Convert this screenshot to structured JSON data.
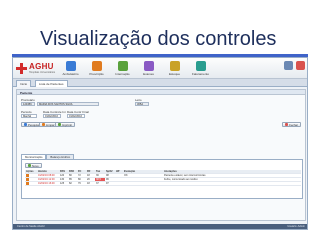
{
  "slide": {
    "title": "Visualização dos controles"
  },
  "app": {
    "logo": {
      "name": "AGHU",
      "tagline": "Hospitais Universitários"
    },
    "modules": [
      {
        "label": "Ambulatório",
        "icon": "stethoscope-icon",
        "color": "#3a7bd5"
      },
      {
        "label": "Prescrição",
        "icon": "pill-icon",
        "color": "#e07b1f"
      },
      {
        "label": "Internação",
        "icon": "bed-icon",
        "color": "#5aa13c"
      },
      {
        "label": "Exames",
        "icon": "microscope-icon",
        "color": "#8a5ac4"
      },
      {
        "label": "Estoque",
        "icon": "box-icon",
        "color": "#c9a227"
      },
      {
        "label": "Faturamento",
        "icon": "chart-icon",
        "color": "#2a9d8f"
      }
    ]
  },
  "tabs": [
    "Início",
    "Lista de Pacientes"
  ],
  "panel": {
    "title": "Paciente",
    "fields": [
      {
        "label": "Prontuário",
        "value": "123456"
      },
      {
        "label": "",
        "value": "MARIA DOS SANTOS SILVA"
      },
      {
        "label": "Leito",
        "value": "305A"
      },
      {
        "label": "Período",
        "value": "Manhã"
      },
      {
        "label": "Data Controle Ini",
        "value": "01/02/2016"
      },
      {
        "label": "Data Contr Final",
        "value": "01/02/2016"
      }
    ],
    "buttons": [
      "Pesquisar",
      "Limpar",
      "Imprimir"
    ],
    "close_label": "Fechar"
  },
  "subtabs": [
    "Monitorização",
    "Balanço Hídrico"
  ],
  "grid": {
    "new_label": "Novo",
    "columns": [
      "Ações",
      "Horário",
      "PAS",
      "PAD",
      "FC",
      "FR",
      "Tax",
      "SpO2",
      "HP",
      "Evolução",
      "Anotações"
    ],
    "rows": [
      [
        "",
        "01/02/16 08:00",
        "120",
        "80",
        "72",
        "18",
        "36",
        "98",
        "",
        "OK",
        "Paciente estável, sem intercorrências"
      ],
      [
        "",
        "01/02/16 12:00",
        "130",
        "85",
        "80",
        "20",
        "38,5",
        "96",
        "",
        "",
        "Febre, comunicado ao médico"
      ],
      [
        "",
        "01/02/16 16:00",
        "125",
        "82",
        "76",
        "18",
        "37",
        "97",
        "",
        "",
        ""
      ]
    ]
  },
  "status": {
    "left": "Centro de Saúde AGHU",
    "right": "Usuário: Admin"
  }
}
